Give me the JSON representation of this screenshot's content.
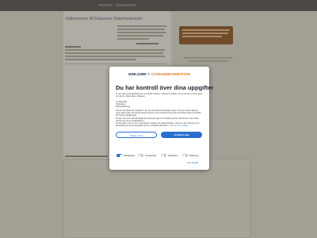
{
  "page": {
    "topbar_title": "",
    "heading": "Välkommen till Dalarnas Säkerhetsradio"
  },
  "consent": {
    "brand": "one.com",
    "plus": "+",
    "cookie_brand": "COOKIEINFORMATION",
    "title": "Du har kontroll över dina uppgifter",
    "intro": "Vi och våra samarbetspartners använder tekniker, inklusive cookies, för att samla in information om dig för olika syften, inklusive:",
    "purposes": [
      "Funktionella",
      "Statistiska",
      "Marknadsföring"
    ],
    "details": "Genom att klicka på \"Godkänn\" ger du samtycke till samtliga syften. Du kan också välja att ange vilka syften du vill samtycka till genom att använda kryssrutorna bredvid syftet och klicka på \"Spara inställningar\".",
    "withdraw": "Du kan när som helst återkalla ditt samtycke genom att klicka på den lilla ikonen i det nedre vänstra hörnet av webbplatsen.",
    "privacy_text": "Du kan läsa mer om hur vi använder cookies och andra tekniker, samt om vår insamling och behandling av personuppgifter genom att klicka på länken.",
    "privacy_link": "Läs mer om cookies",
    "save_label": "Spara urval",
    "accept_label": "Godkänn alla",
    "categories": [
      {
        "label": "Nödvändiga",
        "on": true
      },
      {
        "label": "Funktionella",
        "on": false
      },
      {
        "label": "Statistiska",
        "on": false
      },
      {
        "label": "Marketing",
        "on": false
      }
    ],
    "show_details": "Visa detaljer"
  }
}
